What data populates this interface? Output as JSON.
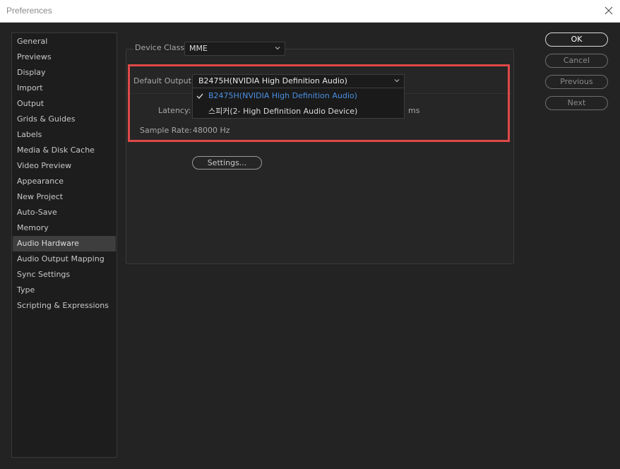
{
  "window": {
    "title": "Preferences"
  },
  "sidebar": {
    "items": [
      {
        "label": "General"
      },
      {
        "label": "Previews"
      },
      {
        "label": "Display"
      },
      {
        "label": "Import"
      },
      {
        "label": "Output"
      },
      {
        "label": "Grids & Guides"
      },
      {
        "label": "Labels"
      },
      {
        "label": "Media & Disk Cache"
      },
      {
        "label": "Video Preview"
      },
      {
        "label": "Appearance"
      },
      {
        "label": "New Project"
      },
      {
        "label": "Auto-Save"
      },
      {
        "label": "Memory"
      },
      {
        "label": "Audio Hardware",
        "selected": true
      },
      {
        "label": "Audio Output Mapping"
      },
      {
        "label": "Sync Settings"
      },
      {
        "label": "Type"
      },
      {
        "label": "Scripting & Expressions"
      }
    ]
  },
  "audio_hardware": {
    "device_class_label": "Device Class:",
    "device_class_value": "MME",
    "default_output_label": "Default Output:",
    "default_output_value": "B2475H(NVIDIA High Definition Audio)",
    "latency_label": "Latency:",
    "latency_unit": "ms",
    "sample_rate_label": "Sample Rate:",
    "sample_rate_value": "48000 Hz",
    "settings_button": "Settings...",
    "output_options": [
      {
        "label": "B2475H(NVIDIA High Definition Audio)",
        "checked": true
      },
      {
        "label": "스피커(2- High Definition Audio Device)",
        "checked": false
      }
    ]
  },
  "buttons": {
    "ok": "OK",
    "cancel": "Cancel",
    "previous": "Previous",
    "next": "Next"
  },
  "colors": {
    "highlight_border": "#e04848",
    "selected_option": "#4a90e2"
  },
  "icons": {
    "close": "close-icon",
    "chevron": "chevron-down-icon",
    "check": "check-icon"
  }
}
